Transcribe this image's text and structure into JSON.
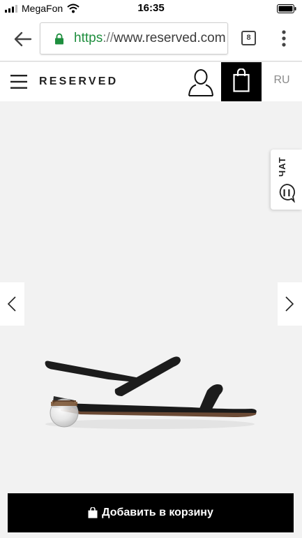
{
  "status_bar": {
    "carrier": "MegaFon",
    "time": "16:35",
    "icons": [
      "signal-icon",
      "wifi-icon",
      "battery-icon"
    ]
  },
  "browser": {
    "url_scheme": "https",
    "url_separator": "://",
    "url_host": "www.reserved.com",
    "tab_count": "8",
    "icons": [
      "back-arrow-icon",
      "lock-icon",
      "tabs-icon",
      "more-vert-icon"
    ],
    "secure_color": "#1e8e3e"
  },
  "header": {
    "brand": "RESERVED",
    "language": "RU",
    "icons": [
      "hamburger-menu-icon",
      "user-icon",
      "shopping-bag-icon"
    ]
  },
  "gallery": {
    "chat_label": "ЧАТ",
    "icons": [
      "chevron-left-icon",
      "chevron-right-icon",
      "chat-bubble-icon"
    ],
    "image": "product-sandal-image"
  },
  "cart": {
    "add_label": "Добавить в корзину",
    "icon": "shopping-bag-icon"
  }
}
